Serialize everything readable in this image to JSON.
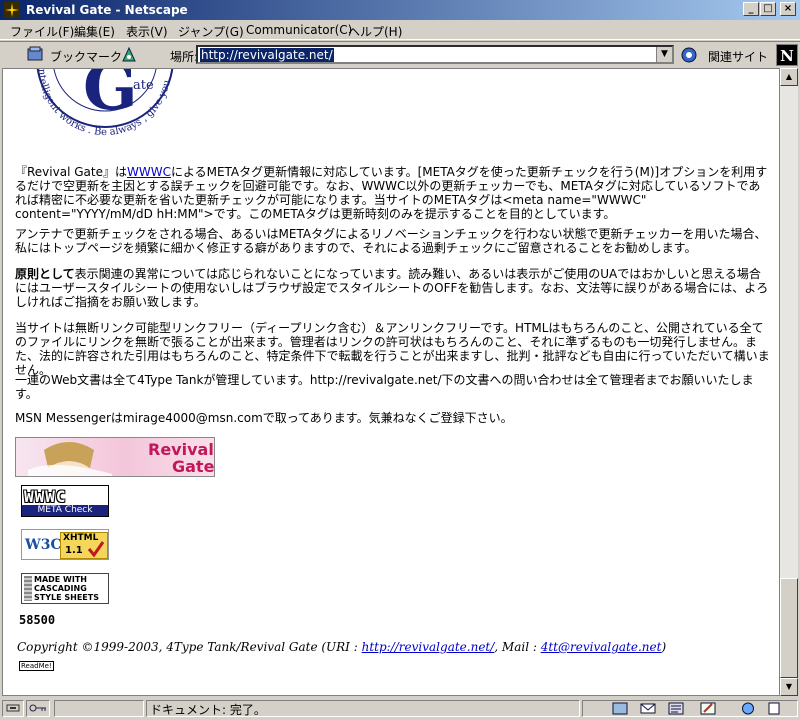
{
  "window": {
    "title": "Revival Gate - Netscape",
    "minimize": "_",
    "maximize": "□",
    "close": "×"
  },
  "menu": [
    "ファイル(F)",
    "編集(E)",
    "表示(V)",
    "ジャンプ(G)",
    "Communicator(C)",
    "ヘルプ(H)"
  ],
  "toolbar": {
    "bookmarks_label": "ブックマーク",
    "location_label": "場所:",
    "url": "http://revivalgate.net/",
    "related_label": "関連サイト"
  },
  "content": {
    "logo_letter": "G",
    "logo_small": "ate",
    "logo_ring_text": "ntelligent works . Be always , give you",
    "p1_a": "『Revival Gate』は",
    "p1_link": "WWWC",
    "p1_b": "によるMETAタグ更新情報に対応しています。[METAタグを使った更新チェックを行う(M)]オプションを利用するだけで空更新を主因とする誤チェックを回避可能です。なお、WWWC以外の更新チェッカーでも、METAタグに対応しているソフトであれば精密に不必要な更新を省いた更新チェックが可能になります。当サイトのMETAタグは<meta name=\"WWWC\" content=\"YYYY/mM/dD hH:MM\">です。このMETAタグは更新時刻のみを提示することを目的としています。",
    "p2": "アンテナで更新チェックをされる場合、あるいはMETAタグによるリノベーションチェックを行わない状態で更新チェッカーを用いた場合、私にはトップページを頻繁に細かく修正する癖がありますので、それによる過剰チェックにご留意されることをお勧めします。",
    "p3_bold": "原則として",
    "p3": "表示関連の異常については応じられないことになっています。読み難い、あるいは表示がご使用のUAではおかしいと思える場合にはユーザースタイルシートの使用ないしはブラウザ設定でスタイルシートのOFFを勧告します。なお、文法等に誤りがある場合には、よろしければご指摘をお願い致します。",
    "p4": "当サイトは無断リンク可能型リンクフリー（ディープリンク含む）＆アンリンクフリーです。HTMLはもちろんのこと、公開されている全てのファイルにリンクを無断で張ることが出来ます。管理者はリンクの許可状はもちろんのこと、それに準ずるものも一切発行しません。また、法的に許容された引用はもちろんのこと、特定条件下で転載を行うことが出来ますし、批判・批評なども自由に行っていただいて構いません。",
    "p5": "一連のWeb文書は全て4Type Tankが管理しています。http://revivalgate.net/下の文書への問い合わせは全て管理者までお願いいたします。",
    "p6": "MSN Messengerはmirage4000@msn.comで取ってあります。気兼ねなくご登録下さい。",
    "banner_line1": "Revival",
    "banner_line2": "Gate",
    "wwwc_badge": "WWWC",
    "wwwc_sub": "META Check",
    "w3c_label": "W3C",
    "xhtml_label": "XHTML",
    "xhtml_ver": "1.1",
    "css_line1": "MADE WITH",
    "css_line2": "CASCADING",
    "css_line3": "STYLE SHEETS",
    "counter": "58500",
    "copyright_a": "Copyright ©1999-2003, 4Type Tank/Revival Gate (URI : ",
    "copyright_link1": "http://revivalgate.net/",
    "copyright_b": ", Mail : ",
    "copyright_link2": "4tt@revivalgate.net",
    "copyright_c": ")",
    "readme": "ReadMe!"
  },
  "status": {
    "text": "ドキュメント: 完了。"
  }
}
